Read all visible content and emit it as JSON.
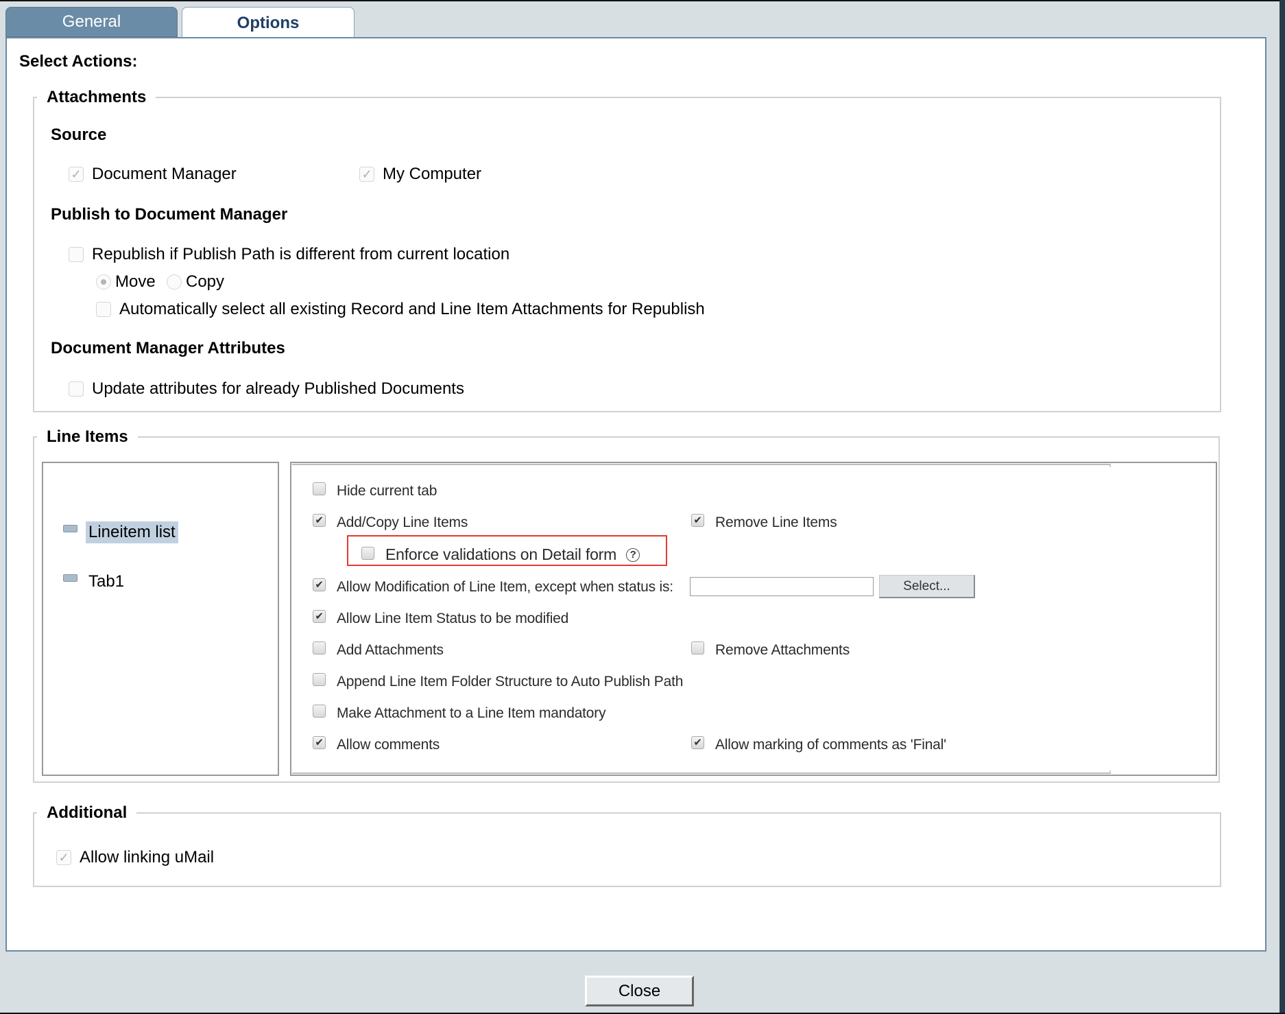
{
  "tabs": [
    {
      "label": "General",
      "active": false
    },
    {
      "label": "Options",
      "active": true
    }
  ],
  "heading": "Select Actions:",
  "attachments": {
    "legend": "Attachments",
    "source": {
      "title": "Source",
      "items": [
        {
          "label": "Document Manager",
          "checked": true,
          "disabled": true
        },
        {
          "label": "My Computer",
          "checked": true,
          "disabled": true
        }
      ]
    },
    "publish": {
      "title": "Publish to Document Manager",
      "republish": {
        "label": "Republish if Publish Path is different from current location",
        "checked": false
      },
      "mode_options": [
        {
          "label": "Move",
          "selected": true
        },
        {
          "label": "Copy",
          "selected": false
        }
      ],
      "auto_select": {
        "label": "Automatically select all existing Record and Line Item Attachments for Republish",
        "checked": false
      }
    },
    "attributes": {
      "title": "Document Manager Attributes",
      "update": {
        "label": "Update attributes for already Published Documents",
        "checked": false
      }
    }
  },
  "line_items": {
    "legend": "Line Items",
    "tree": [
      {
        "label": "Lineitem list",
        "selected": true
      },
      {
        "label": "Tab1",
        "selected": false
      }
    ],
    "options": {
      "hide_current_tab": {
        "label": "Hide current tab",
        "checked": false
      },
      "add_copy": {
        "label": "Add/Copy Line Items",
        "checked": true
      },
      "remove_line_items": {
        "label": "Remove Line Items",
        "checked": true
      },
      "enforce_validations": {
        "label": "Enforce validations on Detail form",
        "checked": false,
        "help": "?"
      },
      "allow_modification": {
        "label": "Allow Modification of Line Item, except when status is:",
        "checked": true,
        "status_value": "",
        "select_button": "Select..."
      },
      "allow_status_modified": {
        "label": "Allow Line Item Status to be modified",
        "checked": true
      },
      "add_attachments": {
        "label": "Add Attachments",
        "checked": false
      },
      "remove_attachments": {
        "label": "Remove Attachments",
        "checked": false
      },
      "append_folder": {
        "label": "Append Line Item Folder Structure to Auto Publish Path",
        "checked": false
      },
      "mandatory_attachment": {
        "label": "Make Attachment to a Line Item mandatory",
        "checked": false
      },
      "allow_comments": {
        "label": "Allow comments",
        "checked": true
      },
      "allow_final": {
        "label": "Allow marking of comments as 'Final'",
        "checked": true
      }
    }
  },
  "additional": {
    "legend": "Additional",
    "allow_umail": {
      "label": "Allow linking uMail",
      "checked": true,
      "disabled": true
    }
  },
  "footer": {
    "close_label": "Close"
  },
  "colors": {
    "tab_active_text": "#1f3e66",
    "tab_inactive_bg": "#6a8ca6",
    "panel_border": "#6b8aa3",
    "highlight": "#e23b2e",
    "window_bg": "#d8dfe3"
  }
}
